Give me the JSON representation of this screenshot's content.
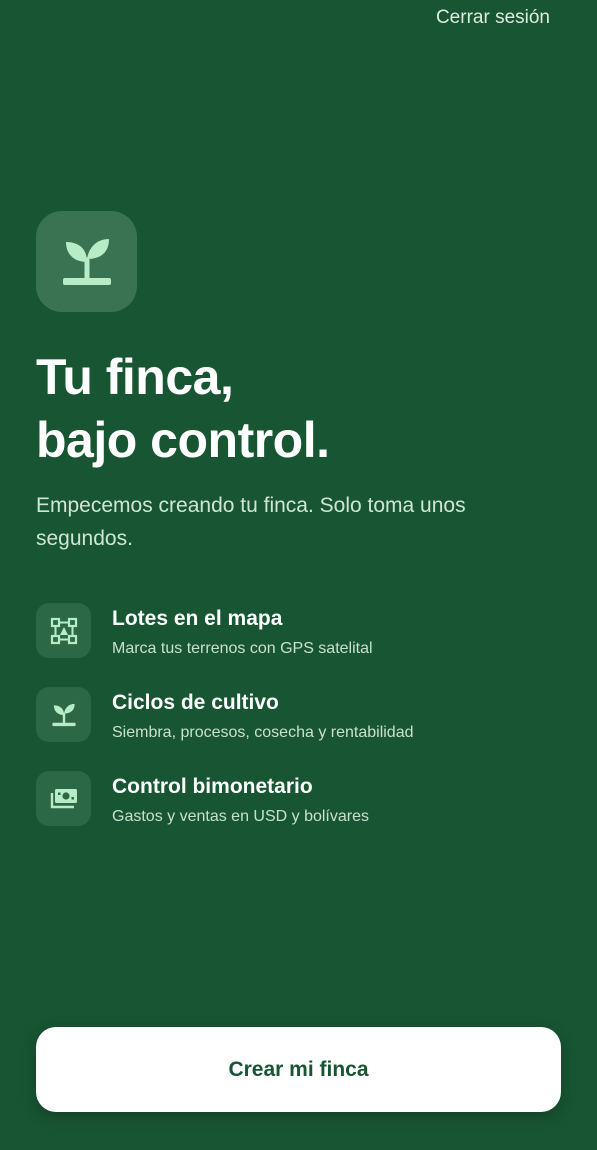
{
  "header": {
    "logout_label": "Cerrar sesión"
  },
  "app_icon": {
    "icon": "sprout-icon",
    "background_color": "#3a7352",
    "icon_color": "#b8ecc6"
  },
  "hero": {
    "title_line1": "Tu finca,",
    "title_line2": "bajo control.",
    "subtitle": "Empecemos creando tu finca. Solo toma unos segundos."
  },
  "features": [
    {
      "icon": "map-plot-icon",
      "title": "Lotes en el mapa",
      "subtitle": "Marca tus terrenos con GPS satelital"
    },
    {
      "icon": "sprout-icon",
      "title": "Ciclos de cultivo",
      "subtitle": "Siembra, procesos, cosecha y rentabilidad"
    },
    {
      "icon": "money-icon",
      "title": "Control bimonetario",
      "subtitle": "Gastos y ventas en USD y bolívares"
    }
  ],
  "cta": {
    "label": "Crear mi finca"
  },
  "colors": {
    "background": "#185532",
    "accent": "#b8ecc6",
    "button_background": "#ffffff",
    "button_text": "#185532"
  }
}
